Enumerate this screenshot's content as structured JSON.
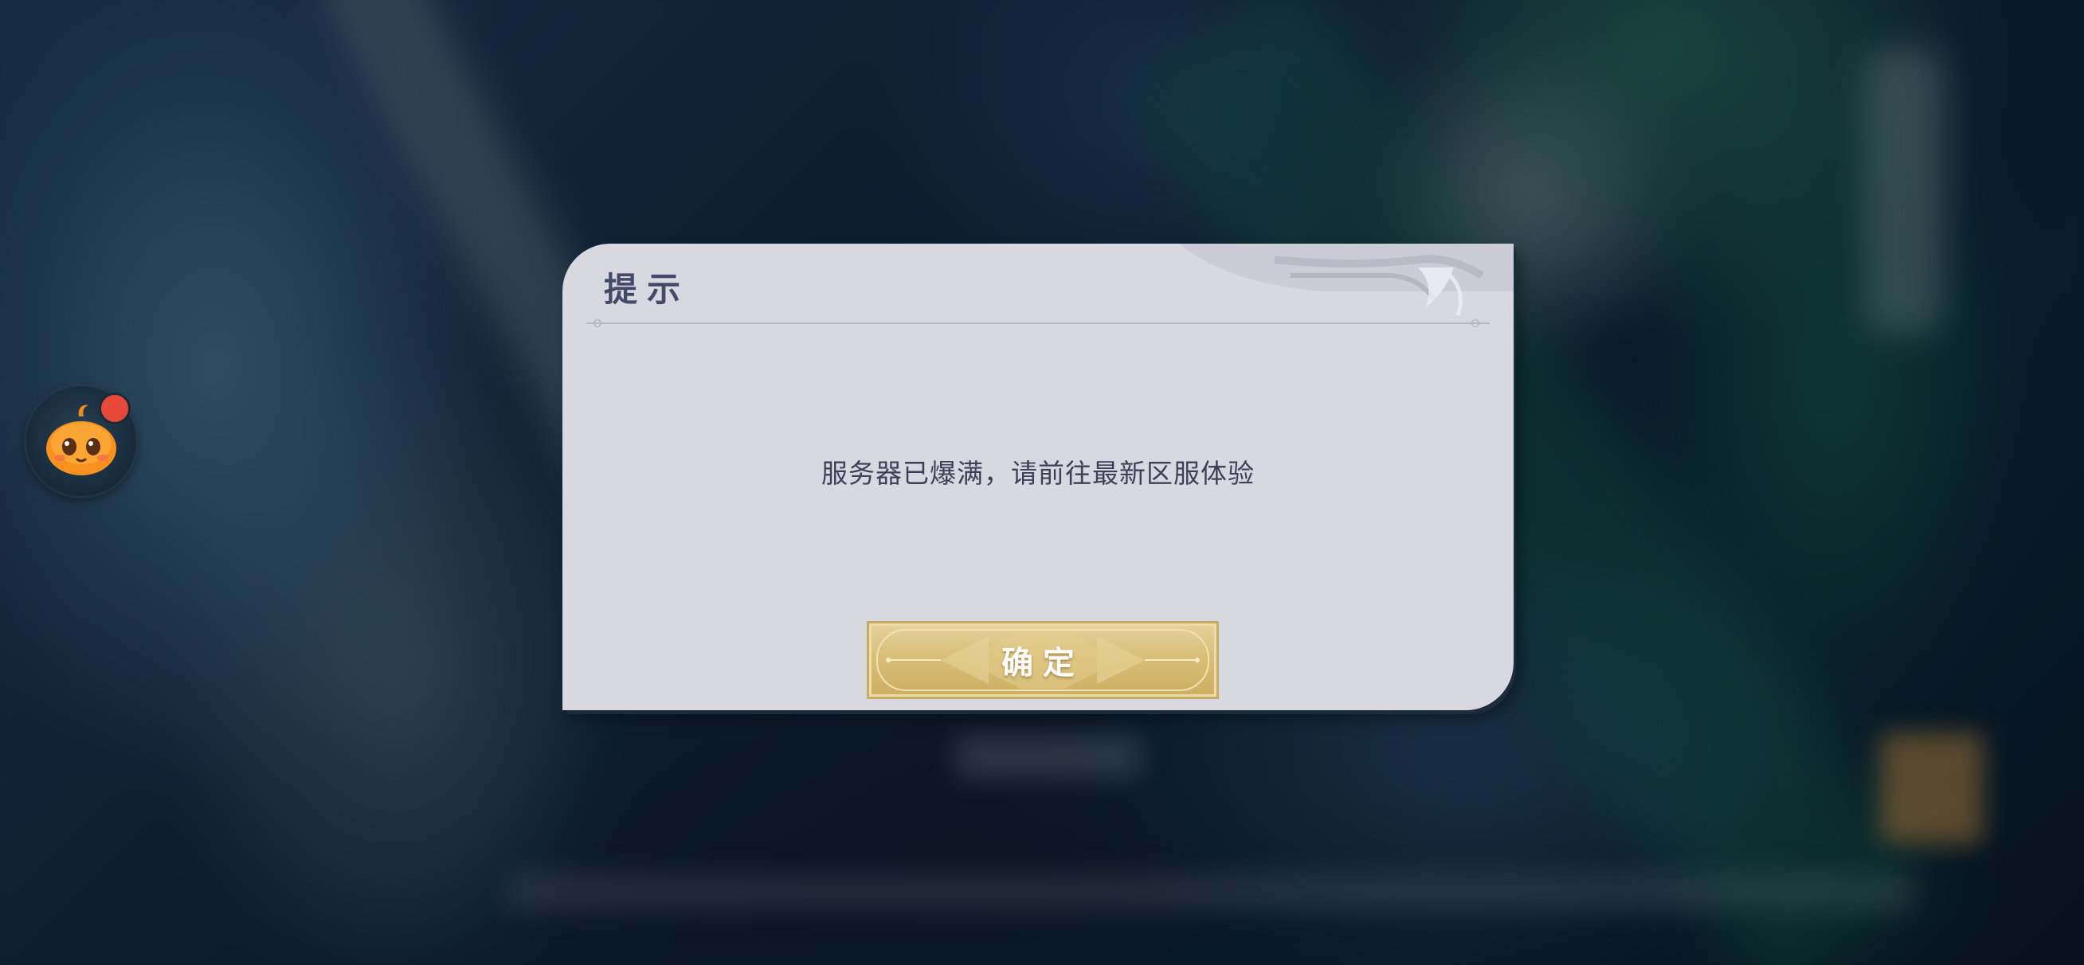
{
  "dialog": {
    "title": "提示",
    "message": "服务器已爆满，请前往最新区服体验",
    "confirm_label": "确定"
  },
  "assistant": {
    "icon": "pumpkin-mascot-icon",
    "has_notification": true
  },
  "colors": {
    "dialog_bg": "#d8d8e1",
    "title": "#464a6a",
    "message": "#3e4058",
    "button_gold": "#d9bf78",
    "badge_red": "#e8483a"
  }
}
